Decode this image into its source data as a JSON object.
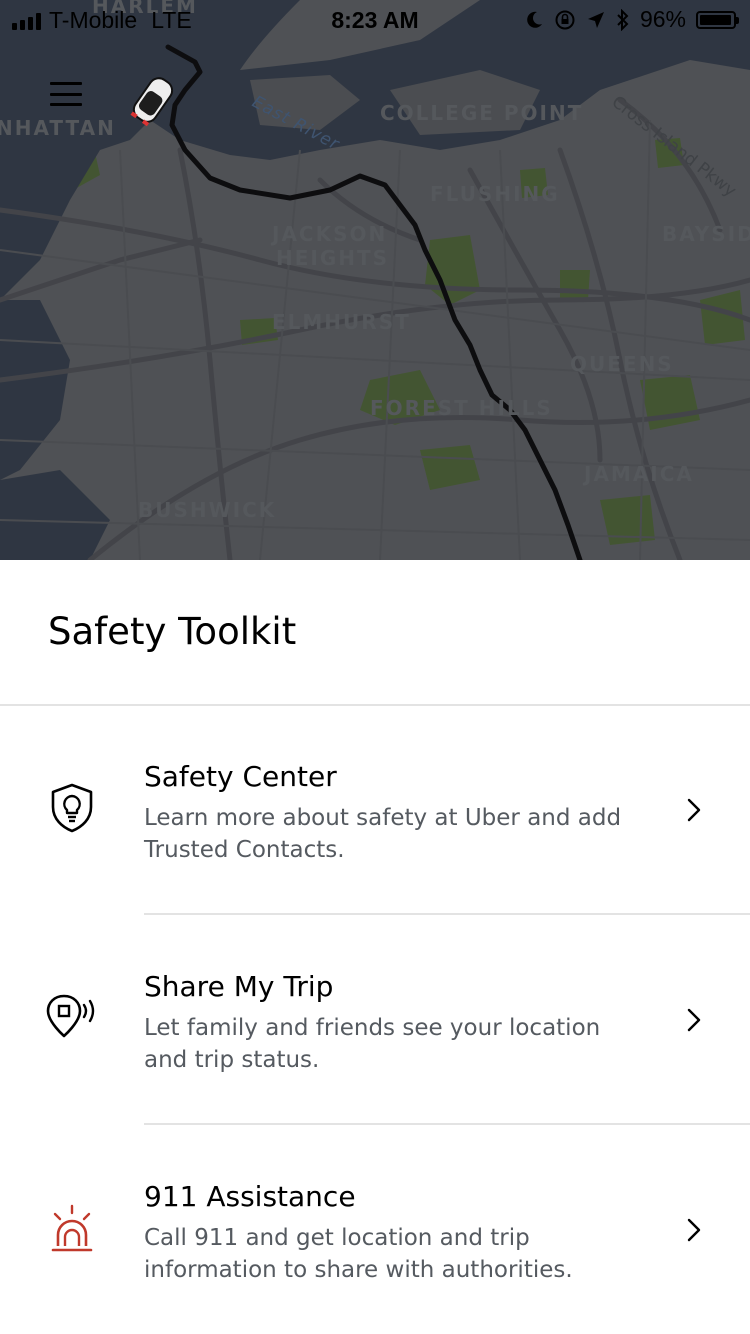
{
  "status_bar": {
    "carrier": "T-Mobile",
    "network": "LTE",
    "time": "8:23 AM",
    "battery_text": "96%",
    "battery_level": 0.96
  },
  "map": {
    "labels": {
      "harlem": "HARLEM",
      "manhattan": "NHATTAN",
      "east_river": "East River",
      "college_point": "COLLEGE POINT",
      "cross_island": "Cross Island Pkwy",
      "flushing": "FLUSHING",
      "bayside": "BAYSIDE",
      "jackson": "JACKSON",
      "heights": "HEIGHTS",
      "elmhurst": "ELMHURST",
      "queens": "QUEENS",
      "forest_hills": "FOREST HILLS",
      "jamaica": "JAMAICA",
      "bushwick": "BUSHWICK"
    },
    "icons": {
      "car": "car-icon",
      "menu": "hamburger-menu-icon"
    }
  },
  "sheet": {
    "title": "Safety Toolkit",
    "items": [
      {
        "icon": "shield-lightbulb-icon",
        "title": "Safety Center",
        "description": "Learn more about safety at Uber and add Trusted Contacts."
      },
      {
        "icon": "location-broadcast-icon",
        "title": "Share My Trip",
        "description": "Let family and friends see your location and trip status."
      },
      {
        "icon": "siren-icon",
        "title": "911 Assistance",
        "description": "Call 911 and get location and trip information to share with authorities.",
        "icon_color": "#c0392b"
      }
    ]
  },
  "colors": {
    "accent_red": "#c0392b",
    "map_water": "#3a4656",
    "map_park": "#5b7a3a",
    "route": "#000000"
  }
}
